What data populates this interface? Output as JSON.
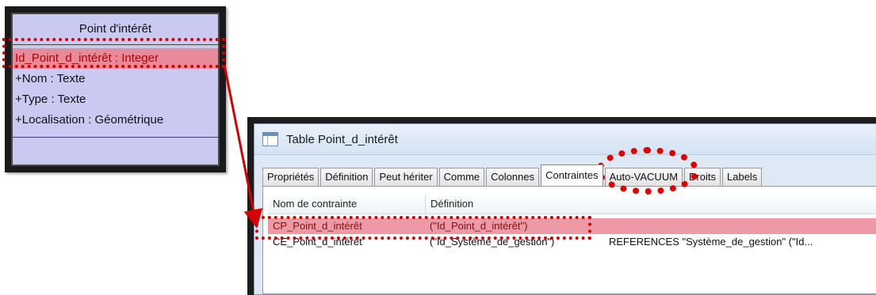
{
  "uml": {
    "title": "Point d'intérêt",
    "attributes": [
      "Id_Point_d_intérêt : Integer",
      "+Nom : Texte",
      "+Type : Texte",
      "+Localisation : Géométrique"
    ]
  },
  "window": {
    "title": "Table Point_d_intérêt",
    "tabs": [
      "Propriétés",
      "Définition",
      "Peut hériter",
      "Comme",
      "Colonnes",
      "Contraintes",
      "Auto-VACUUM",
      "Droits",
      "Labels"
    ],
    "active_tab": "Contraintes",
    "table": {
      "columns": [
        "Nom de contrainte",
        "Définition"
      ],
      "rows": [
        {
          "name": "CP_Point_d_intérêt",
          "definition": "(\"Id_Point_d_intérêt\")",
          "extra": ""
        },
        {
          "name": "CE_Point_d_intérêt",
          "definition": "(\"Id_Système_de_gestion\")",
          "extra": "REFERENCES \"Système_de_gestion\" (\"Id..."
        }
      ]
    }
  },
  "colors": {
    "highlight": "#d60000",
    "uml_bg": "#c9c9f2",
    "key_row_bg": "#e88a9a"
  }
}
